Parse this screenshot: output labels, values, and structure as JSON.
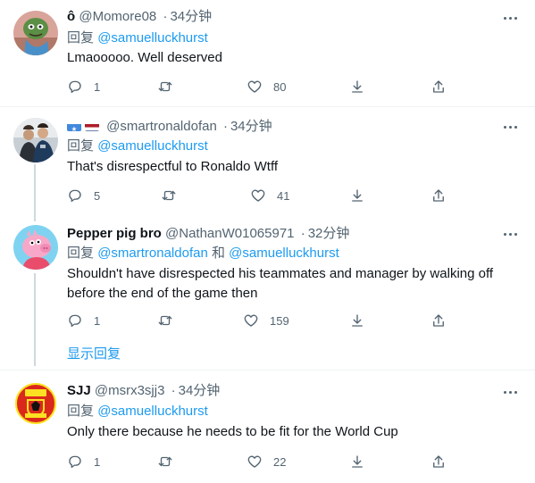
{
  "tweets": [
    {
      "name": "ô",
      "handle": "@Momore08",
      "time": "34分钟",
      "reply_prefix": "回复",
      "mentions": [
        "@samuelluckhurst"
      ],
      "text": "Lmaooooo. Well deserved",
      "replies": "1",
      "retweets": "",
      "likes": "80"
    },
    {
      "name": "",
      "handle": "@smartronaldofan",
      "time": "34分钟",
      "reply_prefix": "回复",
      "mentions": [
        "@samuelluckhurst"
      ],
      "text": "That's disrespectful to Ronaldo Wtff",
      "replies": "5",
      "retweets": "",
      "likes": "41"
    },
    {
      "name": "Pepper pig bro",
      "handle": "@NathanW01065971",
      "time": "32分钟",
      "reply_prefix": "回复",
      "mentions": [
        "@smartronaldofan",
        "@samuelluckhurst"
      ],
      "mention_joiner": "和",
      "text": "Shouldn't have disrespected his teammates and manager by walking off before the end of the game then",
      "replies": "1",
      "retweets": "",
      "likes": "159"
    },
    {
      "name": "SJJ",
      "handle": "@msrx3sjj3",
      "time": "34分钟",
      "reply_prefix": "回复",
      "mentions": [
        "@samuelluckhurst"
      ],
      "text": "Only there because he needs to be fit for the World Cup",
      "replies": "1",
      "retweets": "",
      "likes": "22"
    }
  ],
  "show_replies_label": "显示回复",
  "separator_dot": "·",
  "colors": {
    "link": "#1d9bf0",
    "secondary": "#536471",
    "divider": "#eff3f4",
    "thread_line": "#cfd9de"
  },
  "icons": [
    "reply-icon",
    "retweet-icon",
    "like-icon",
    "share-icon",
    "upload-icon",
    "more-icon"
  ]
}
